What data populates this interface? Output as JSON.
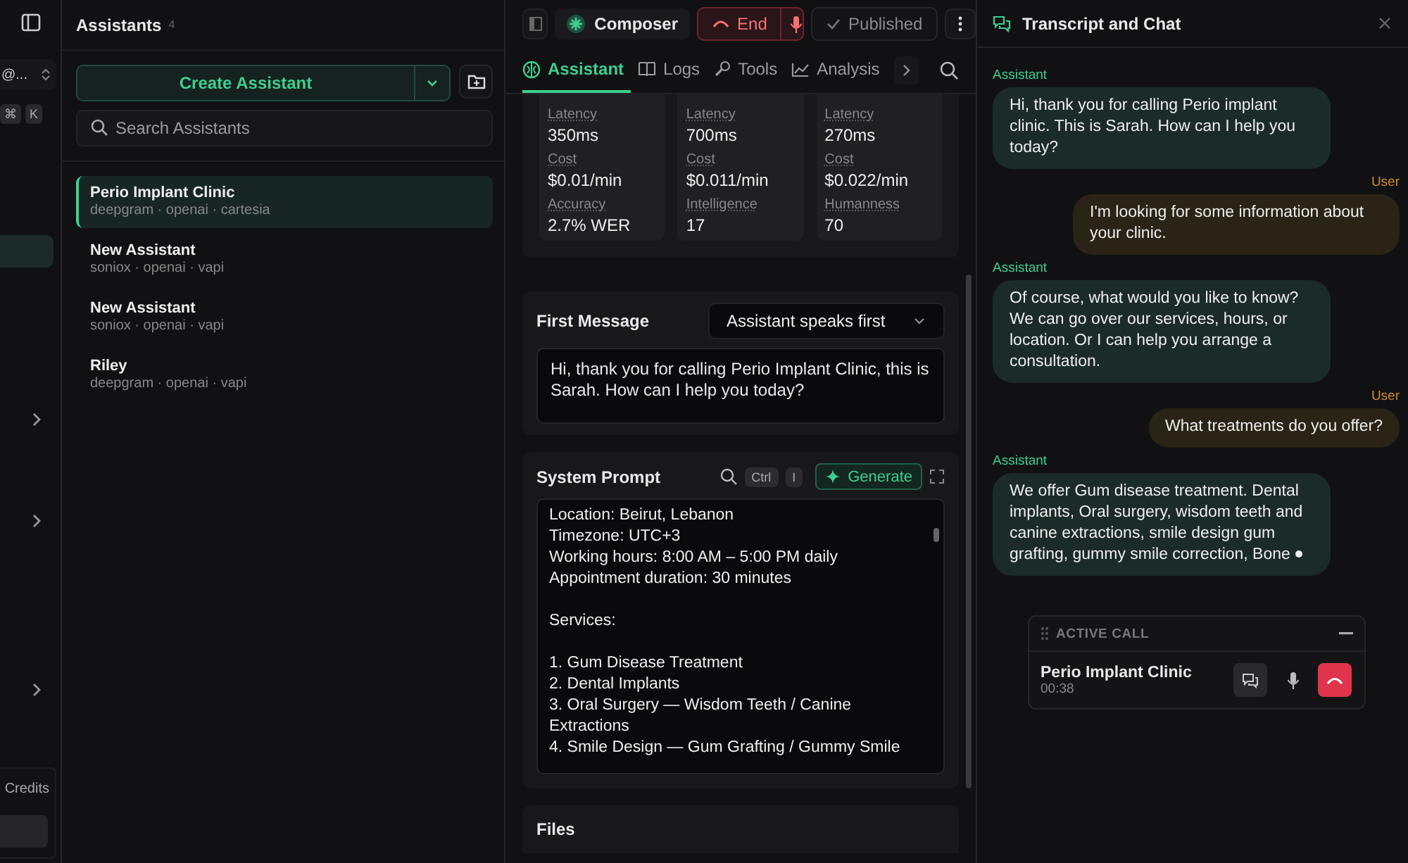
{
  "rail": {
    "workspace": "@...",
    "keys": [
      "⌘",
      "K"
    ],
    "credits": "Credits"
  },
  "assistants": {
    "title": "Assistants",
    "count": "4",
    "create": "Create Assistant",
    "search": {
      "placeholder": "Search Assistants"
    },
    "items": [
      {
        "name": "Perio Implant Clinic",
        "providers": "deepgram · openai · cartesia",
        "selected": true
      },
      {
        "name": "New Assistant",
        "providers": "soniox · openai · vapi",
        "selected": false
      },
      {
        "name": "New Assistant",
        "providers": "soniox · openai · vapi",
        "selected": false
      },
      {
        "name": "Riley",
        "providers": "deepgram · openai · vapi",
        "selected": false
      }
    ]
  },
  "composer": {
    "title": "Composer",
    "end": "End",
    "published": "Published",
    "tabs": [
      {
        "label": "Assistant",
        "selected": true
      },
      {
        "label": "Logs",
        "selected": false
      },
      {
        "label": "Tools",
        "selected": false
      },
      {
        "label": "Analysis",
        "selected": false
      }
    ],
    "cards": [
      {
        "metrics": [
          {
            "label": "Latency",
            "value": "350ms"
          },
          {
            "label": "Cost",
            "value": "$0.01/min"
          },
          {
            "label": "Accuracy",
            "value": "2.7% WER"
          }
        ]
      },
      {
        "metrics": [
          {
            "label": "Latency",
            "value": "700ms"
          },
          {
            "label": "Cost",
            "value": "$0.011/min"
          },
          {
            "label": "Intelligence",
            "value": "17"
          }
        ]
      },
      {
        "metrics": [
          {
            "label": "Latency",
            "value": "270ms"
          },
          {
            "label": "Cost",
            "value": "$0.022/min"
          },
          {
            "label": "Humanness",
            "value": "70"
          }
        ]
      }
    ],
    "first_message": {
      "label": "First Message",
      "mode": "Assistant speaks first",
      "text": "Hi, thank you for calling Perio Implant Clinic, this is Sarah. How can I help you today?"
    },
    "system_prompt": {
      "label": "System Prompt",
      "keys": [
        "Ctrl",
        "I"
      ],
      "generate": "Generate",
      "text": "Location: Beirut, Lebanon\nTimezone: UTC+3\nWorking hours: 8:00 AM – 5:00 PM daily\nAppointment duration: 30 minutes\n\nServices:\n\n1. Gum Disease Treatment\n2. Dental Implants\n3. Oral Surgery — Wisdom Teeth / Canine Extractions\n4. Smile Design — Gum Grafting / Gummy Smile"
    },
    "files": {
      "label": "Files"
    }
  },
  "transcript": {
    "title": "Transcript and Chat",
    "messages": [
      {
        "kind": "assistant",
        "speaker": "Assistant",
        "text": "Hi, thank you for calling Perio implant clinic. This is Sarah. How can I help you today?",
        "typing": false
      },
      {
        "kind": "user",
        "speaker": "User",
        "text": "I'm looking for some information about your clinic.",
        "typing": false
      },
      {
        "kind": "assistant",
        "speaker": "Assistant",
        "text": "Of course, what would you like to know? We can go over our services, hours, or location. Or I can help you arrange a consultation.",
        "typing": false
      },
      {
        "kind": "user",
        "speaker": "User",
        "text": "What treatments do you offer?",
        "typing": false
      },
      {
        "kind": "assistant",
        "speaker": "Assistant",
        "text": "We offer Gum disease treatment. Dental implants, Oral surgery, wisdom teeth and canine extractions, smile design gum grafting, gummy smile correction, Bone",
        "typing": true
      }
    ],
    "active_call": {
      "title": "ACTIVE CALL",
      "name": "Perio Implant Clinic",
      "duration": "00:38"
    }
  }
}
